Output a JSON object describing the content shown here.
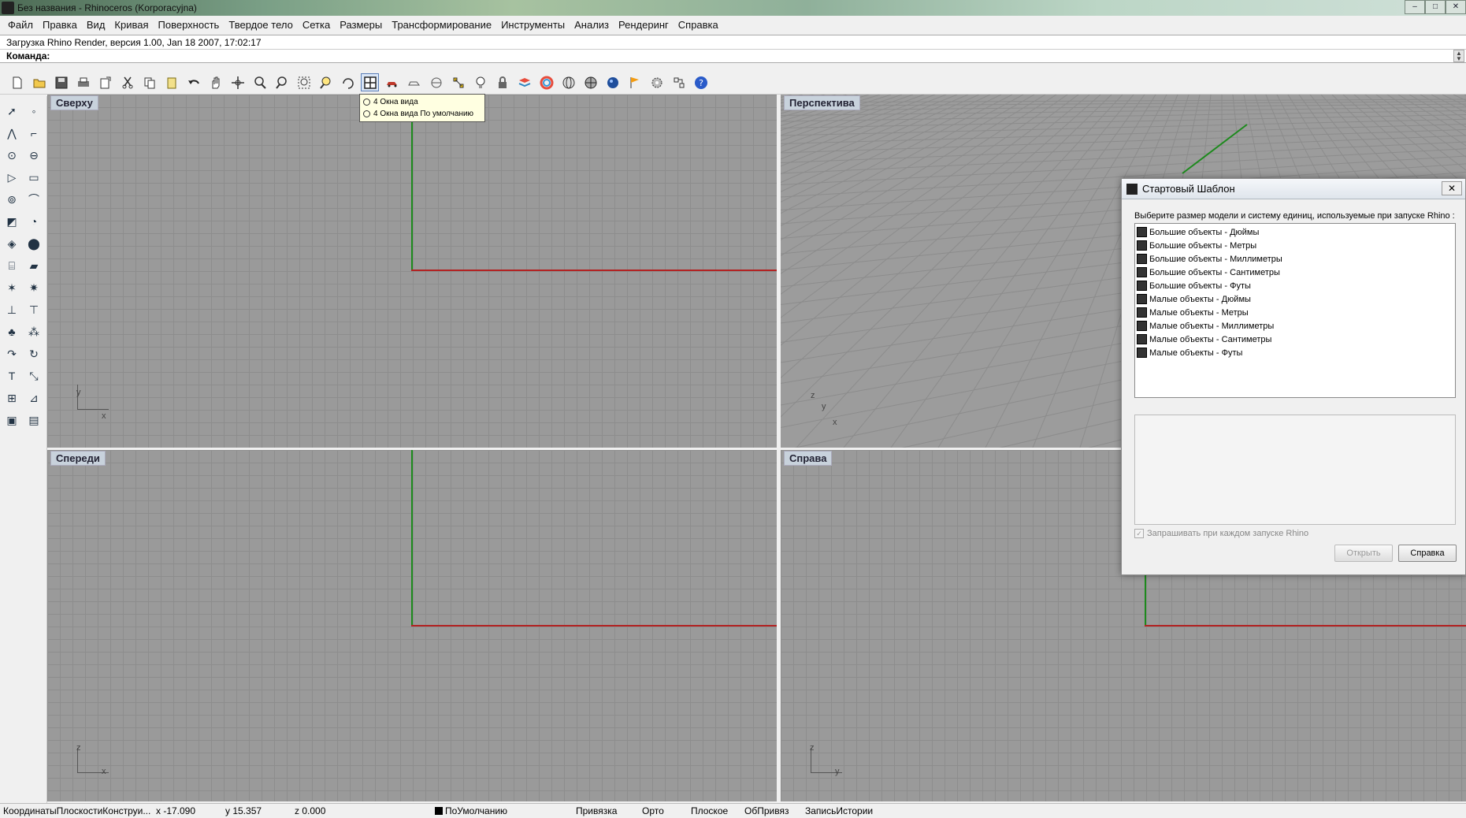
{
  "window": {
    "title": "Без названия - Rhinoceros (Korporacyjna)",
    "buttons": [
      "‒",
      "□",
      "✕"
    ]
  },
  "menu": [
    "Файл",
    "Правка",
    "Вид",
    "Кривая",
    "Поверхность",
    "Твердое тело",
    "Сетка",
    "Размеры",
    "Трансформирование",
    "Инструменты",
    "Анализ",
    "Рендеринг",
    "Справка"
  ],
  "command": {
    "history": "Загрузка Rhino Render, версия 1.00, Jan 18 2007, 17:02:17",
    "prompt": "Команда:"
  },
  "toolbar": {
    "tooltip": [
      "4 Окна вида",
      "4 Окна вида По умолчанию"
    ]
  },
  "viewports": {
    "top": "Сверху",
    "perspective": "Перспектива",
    "front": "Спереди",
    "right": "Справа",
    "axes": {
      "x": "x",
      "y": "y",
      "z": "z"
    }
  },
  "dialog": {
    "title": "Стартовый Шаблон",
    "prompt": "Выберите размер модели и систему единиц, используемые при запуске Rhino :",
    "templates": [
      "Большие объекты - Дюймы",
      "Большие объекты - Метры",
      "Большие объекты - Миллиметры",
      "Большие объекты - Сантиметры",
      "Большие объекты - Футы",
      "Малые объекты - Дюймы",
      "Малые объекты - Метры",
      "Малые объекты - Миллиметры",
      "Малые объекты - Сантиметры",
      "Малые объекты - Футы"
    ],
    "checkbox_label": "Запрашивать при каждом запуске Rhino",
    "checkbox_checked": true,
    "open_button": "Открыть",
    "help_button": "Справка"
  },
  "status": {
    "cplane": "КоординатыПлоскостиКонструи...",
    "x": "x -17.090",
    "y": "y 15.357",
    "z": "z 0.000",
    "layer": "ПоУмолчанию",
    "snap": "Привязка",
    "ortho": "Орто",
    "planar": "Плоское",
    "osnap": "ОбПривяз",
    "history": "ЗаписьИстории"
  },
  "colors": {
    "x_axis": "#b22222",
    "y_axis": "#1d8a1d",
    "viewport_bg": "#9a9a9a",
    "tooltip_bg": "#ffffe1"
  }
}
